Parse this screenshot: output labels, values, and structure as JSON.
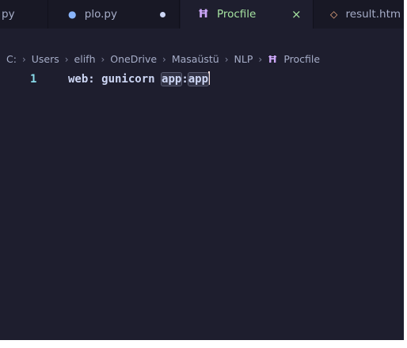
{
  "tabs": [
    {
      "label": "py",
      "state": "inactive"
    },
    {
      "label": "plo.py",
      "icon": "python-file-icon",
      "modified": true,
      "state": "inactive"
    },
    {
      "label": "Procfile",
      "icon": "procfile-icon",
      "state": "active",
      "close_glyph": "×"
    },
    {
      "label": "result.htm",
      "icon": "html-file-icon",
      "state": "inactive"
    }
  ],
  "breadcrumb": [
    "C:",
    "Users",
    "elifh",
    "OneDrive",
    "Masaüstü",
    "NLP",
    "Procfile"
  ],
  "editor": {
    "line_number": "1",
    "code_prefix": "web: gunicorn ",
    "code_match_1": "app",
    "code_colon": ":",
    "code_match_2": "app"
  },
  "icons": {
    "python": "●",
    "procfile": "Ħ",
    "html": "◇",
    "separator": "›"
  },
  "colors": {
    "background": "#1e1e2e",
    "tabbar": "#181825",
    "active_tab_text": "#a6e3a1",
    "line_number": "#89dceb",
    "procfile_icon": "#cba6f7"
  }
}
